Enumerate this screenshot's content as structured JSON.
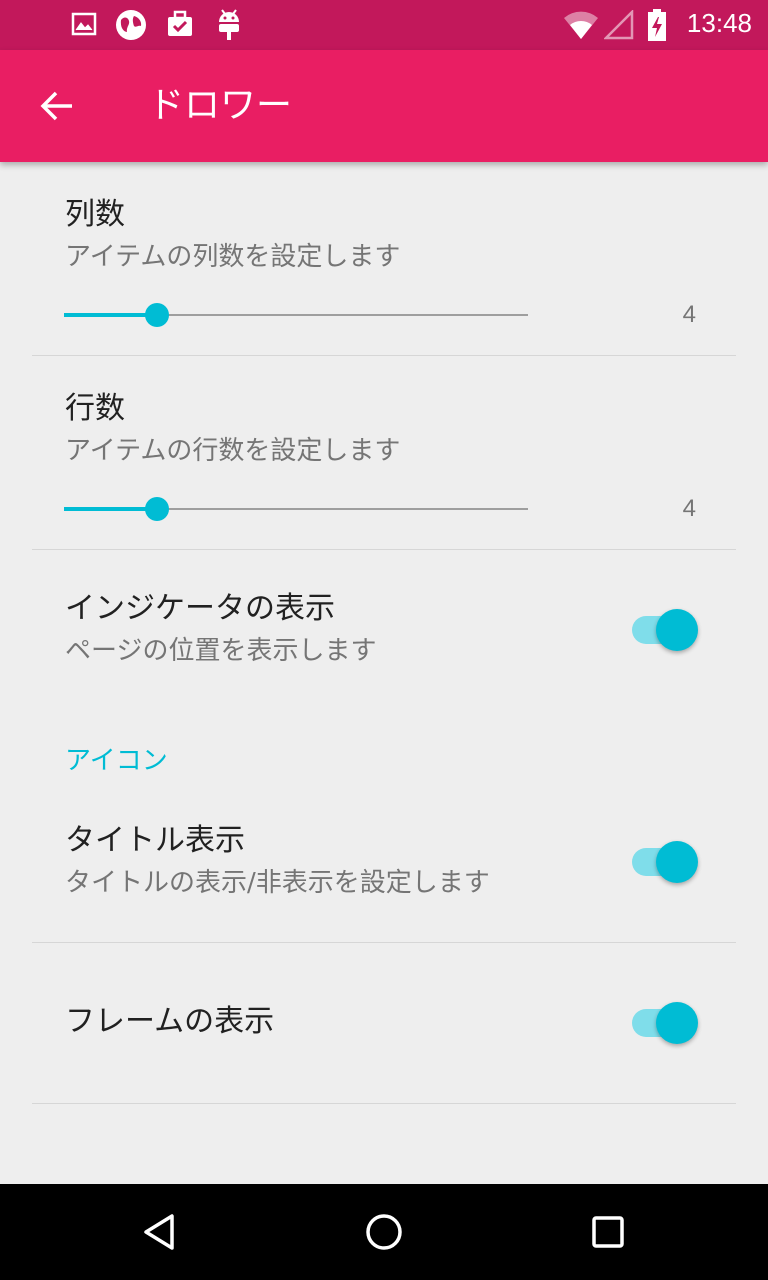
{
  "status_bar": {
    "time": "13:48",
    "icons": [
      "gallery-icon",
      "globe-icon",
      "briefcase-check-icon",
      "android-icon",
      "wifi-icon",
      "signal-icon",
      "battery-charging-icon"
    ]
  },
  "app_bar": {
    "title": "ドロワー",
    "back_icon": "arrow-back-icon"
  },
  "settings": {
    "columns": {
      "title": "列数",
      "summary": "アイテムの列数を設定します",
      "value": "4",
      "fraction": 0.2
    },
    "rows": {
      "title": "行数",
      "summary": "アイテムの行数を設定します",
      "value": "4",
      "fraction": 0.2
    },
    "indicator": {
      "title": "インジケータの表示",
      "summary": "ページの位置を表示します",
      "checked": true
    },
    "icon_category": "アイコン",
    "title_display": {
      "title": "タイトル表示",
      "summary": "タイトルの表示/非表示を設定します",
      "checked": true
    },
    "frame_display": {
      "title": "フレームの表示",
      "checked": true
    }
  },
  "nav_bar": {
    "icons": [
      "back-triangle-icon",
      "home-circle-icon",
      "recents-square-icon"
    ]
  },
  "colors": {
    "status_bar": "#C2185B",
    "app_bar": "#E91E63",
    "accent": "#00BCD4",
    "background": "#EEEEEE"
  }
}
